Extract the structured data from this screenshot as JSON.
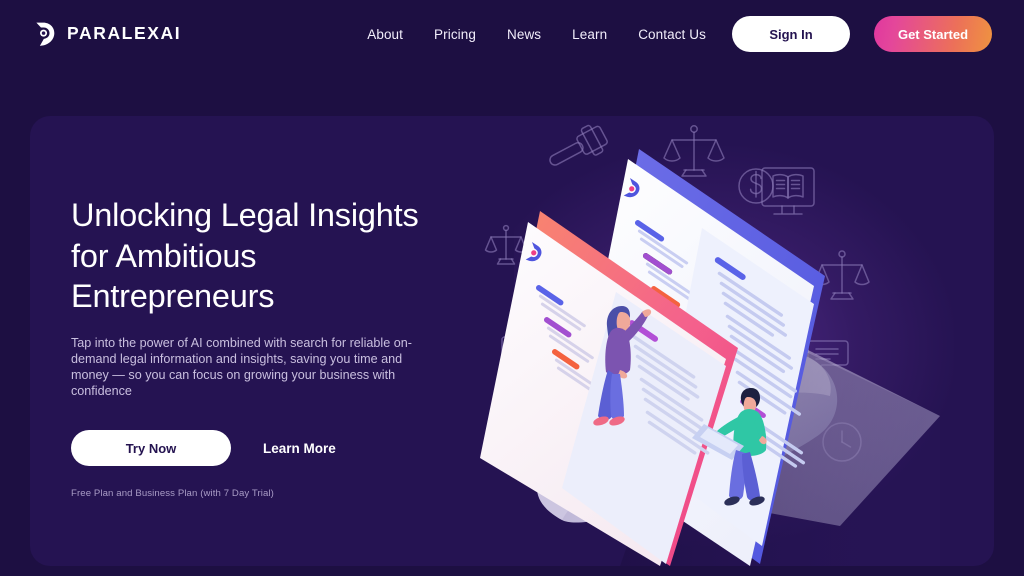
{
  "brand": {
    "name": "PARALEXAI",
    "logo_icon": "paralex-logo-mark"
  },
  "header": {
    "nav": [
      {
        "label": "About"
      },
      {
        "label": "Pricing"
      },
      {
        "label": "News"
      },
      {
        "label": "Learn"
      },
      {
        "label": "Contact Us"
      }
    ],
    "sign_in_label": "Sign In",
    "get_started_label": "Get Started"
  },
  "hero": {
    "title": "Unlocking Legal Insights for Ambitious Entrepreneurs",
    "subtitle": "Tap into the power of AI combined with search for reliable on-demand legal information and insights, saving you time and money — so you can focus on growing your business with confidence",
    "primary_cta": "Try Now",
    "secondary_cta": "Learn More",
    "note": "Free Plan and Business Plan (with 7 Day Trial)"
  },
  "illustration": {
    "alt": "Isometric legal research app screens with two people and legal icons",
    "icons": [
      {
        "name": "gavel-icon"
      },
      {
        "name": "scales-of-justice-icon"
      },
      {
        "name": "dollar-coin-icon"
      },
      {
        "name": "book-on-monitor-icon"
      },
      {
        "name": "scales-of-justice-icon"
      },
      {
        "name": "speech-bubble-icon"
      },
      {
        "name": "clock-icon"
      },
      {
        "name": "document-monitor-icon"
      },
      {
        "name": "scales-of-justice-small-icon"
      }
    ]
  },
  "colors": {
    "page_background": "#1d0f42",
    "card_background": "#251352",
    "accent_pink": "#e0379f",
    "accent_orange": "#ef9340",
    "accent_blue": "#5a63e8",
    "text_primary": "#ffffff",
    "text_muted": "#c9bfdf"
  }
}
